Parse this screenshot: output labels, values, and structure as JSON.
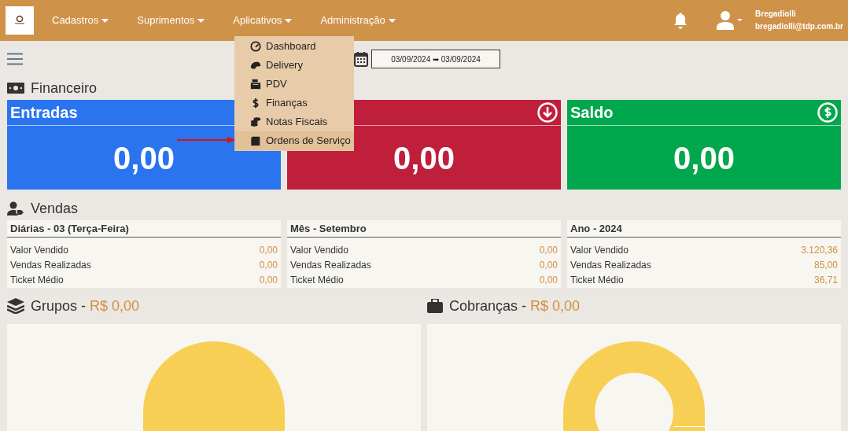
{
  "nav": {
    "menus": [
      {
        "label": "Cadastros"
      },
      {
        "label": "Suprimentos"
      },
      {
        "label": "Aplicativos"
      },
      {
        "label": "Administração"
      }
    ],
    "user": {
      "name": "Bregadiolli",
      "email": "bregadiolli@tdp.com.br"
    }
  },
  "dropdown": [
    {
      "label": "Dashboard",
      "selected": false
    },
    {
      "label": "Delivery",
      "selected": false
    },
    {
      "label": "PDV",
      "selected": false
    },
    {
      "label": "Finanças",
      "selected": false
    },
    {
      "label": "Notas Fiscais",
      "selected": false
    },
    {
      "label": "Ordens de Serviço",
      "selected": true
    }
  ],
  "date_range": {
    "value": "03/09/2024 ➥ 03/09/2024"
  },
  "financeiro": {
    "title": "Financeiro",
    "cards": [
      {
        "title": "Entradas",
        "value": "0,00",
        "color": "#2a74f0"
      },
      {
        "value": "0,00",
        "color": "#c01f3b"
      },
      {
        "title": "Saldo",
        "value": "0,00",
        "color": "#00a74c"
      }
    ]
  },
  "vendas": {
    "title": "Vendas",
    "panels": [
      {
        "title": "Diárias - 03 (Terça-Feira)",
        "rows": [
          {
            "label": "Valor Vendido",
            "value": "0,00"
          },
          {
            "label": "Vendas Realizadas",
            "value": "0,00"
          },
          {
            "label": "Ticket Médio",
            "value": "0,00"
          }
        ]
      },
      {
        "title": "Mês - Setembro",
        "rows": [
          {
            "label": "Valor Vendido",
            "value": "0,00"
          },
          {
            "label": "Vendas Realizadas",
            "value": "0,00"
          },
          {
            "label": "Ticket Médio",
            "value": "0,00"
          }
        ]
      },
      {
        "title": "Ano - 2024",
        "rows": [
          {
            "label": "Valor Vendido",
            "value": "3.120,36"
          },
          {
            "label": "Vendas Realizadas",
            "value": "85,00"
          },
          {
            "label": "Ticket Médio",
            "value": "36,71"
          }
        ]
      }
    ]
  },
  "charts": [
    {
      "title": "Grupos -",
      "amount": "R$ 0,00",
      "kind": "pie"
    },
    {
      "title": "Cobranças -",
      "amount": "R$ 0,00",
      "kind": "donut"
    }
  ]
}
